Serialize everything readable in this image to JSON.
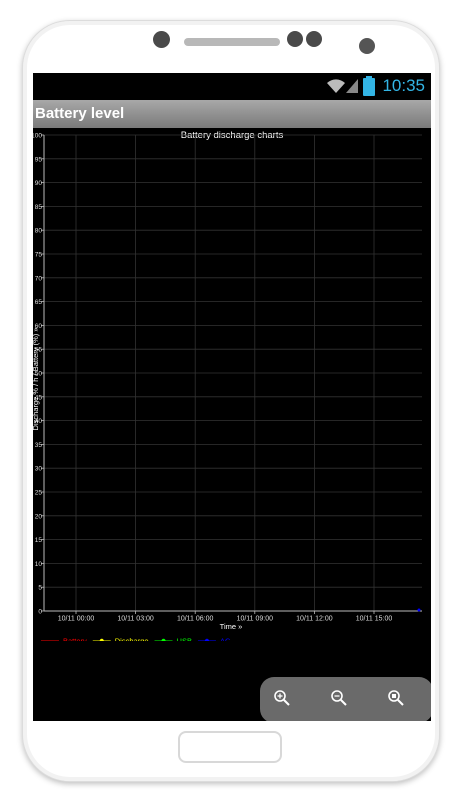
{
  "app": {
    "status_time": "10:35",
    "title": "Battery level"
  },
  "chart": {
    "title": "Battery discharge charts",
    "xlabel": "Time »",
    "ylabel": "Discharge % / h / Battery (%) »"
  },
  "colors": {
    "status_accent": "#33b5e5",
    "battery": "#ff0000",
    "discharge": "#ffff00",
    "usb": "#00ff00",
    "ac": "#0000ff"
  },
  "zoom": {
    "zoom_in_icon": "zoom-in-icon",
    "zoom_out_icon": "zoom-out-icon",
    "reset_icon": "zoom-reset-icon"
  },
  "chart_data": {
    "type": "line",
    "title": "Battery discharge charts",
    "xlabel": "Time »",
    "ylabel": "Discharge % / h / Battery (%) »",
    "ylim": [
      0,
      100
    ],
    "yticks": [
      0,
      5,
      10,
      15,
      20,
      25,
      30,
      35,
      40,
      45,
      50,
      55,
      60,
      65,
      70,
      75,
      80,
      85,
      90,
      95,
      100
    ],
    "xticks": [
      "10/11 00:00",
      "10/11 03:00",
      "10/11 06:00",
      "10/11 09:00",
      "10/11 12:00",
      "10/11 15:00"
    ],
    "grid": true,
    "legend_position": "bottom-left",
    "series": [
      {
        "name": "Battery",
        "color": "#ff0000",
        "values": []
      },
      {
        "name": "Discharge",
        "color": "#ffff00",
        "values": []
      },
      {
        "name": "USB",
        "color": "#00ff00",
        "values": []
      },
      {
        "name": "AC",
        "color": "#0000ff",
        "values": []
      }
    ]
  }
}
